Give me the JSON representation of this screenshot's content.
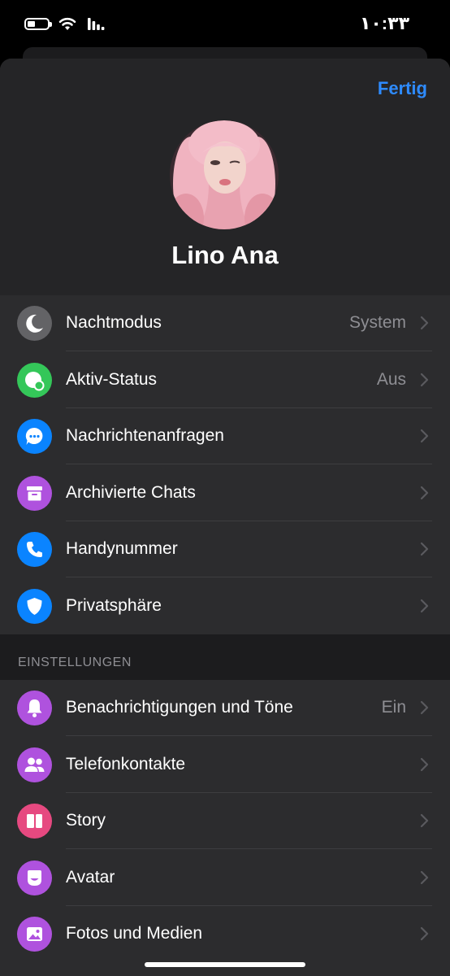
{
  "status_bar": {
    "time": "١٠:٣٣",
    "battery_level": 0.25,
    "wifi_icon": "wifi-icon",
    "signal_icon": "cellular-signal-icon"
  },
  "header": {
    "done_label": "Fertig",
    "profile_name": "Lino Ana",
    "accent_color": "#2e8bff"
  },
  "account_rows": [
    {
      "label": "Nachtmodus",
      "value": "System",
      "icon": "moon-icon",
      "color": "#636366"
    },
    {
      "label": "Aktiv-Status",
      "value": "Aus",
      "icon": "active-status-icon",
      "color": "#34c759"
    },
    {
      "label": "Nachrichtenanfragen",
      "value": "",
      "icon": "message-requests-icon",
      "color": "#0a84ff"
    },
    {
      "label": "Archivierte Chats",
      "value": "",
      "icon": "archive-box-icon",
      "color": "#af52de"
    },
    {
      "label": "Handynummer",
      "value": "",
      "icon": "phone-icon",
      "color": "#0a84ff"
    },
    {
      "label": "Privatsphäre",
      "value": "",
      "icon": "shield-icon",
      "color": "#0a84ff"
    }
  ],
  "settings_section": {
    "title": "EINSTELLUNGEN"
  },
  "settings_rows": [
    {
      "label": "Benachrichtigungen und Töne",
      "value": "Ein",
      "icon": "bell-icon",
      "color": "#af52de"
    },
    {
      "label": "Telefonkontakte",
      "value": "",
      "icon": "contacts-icon",
      "color": "#af52de"
    },
    {
      "label": "Story",
      "value": "",
      "icon": "story-icon",
      "color": "#e64980"
    },
    {
      "label": "Avatar",
      "value": "",
      "icon": "avatar-face-icon",
      "color": "#af52de"
    },
    {
      "label": "Fotos und Medien",
      "value": "",
      "icon": "photo-icon",
      "color": "#af52de"
    }
  ]
}
